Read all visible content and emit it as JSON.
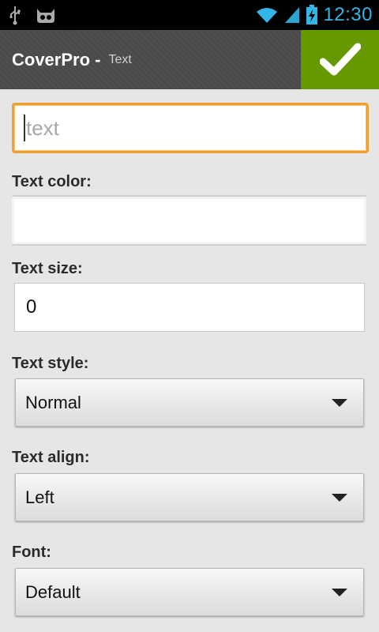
{
  "status_bar": {
    "time": "12:30",
    "icons": [
      "usb-icon",
      "cyanogen-icon",
      "wifi-icon",
      "signal-icon",
      "battery-charging-icon"
    ],
    "accent": "#33b5e5"
  },
  "action_bar": {
    "app_name": "CoverPro -",
    "subtitle": "Text",
    "confirm_icon": "checkmark-icon",
    "confirm_color": "#669900"
  },
  "form": {
    "text": {
      "value": "",
      "placeholder": "text"
    },
    "text_color_label": "Text color:",
    "text_size_label": "Text size:",
    "text_size_value": "0",
    "text_style_label": "Text style:",
    "text_style_value": "Normal",
    "text_align_label": "Text align:",
    "text_align_value": "Left",
    "font_label": "Font:",
    "font_value": "Default"
  }
}
